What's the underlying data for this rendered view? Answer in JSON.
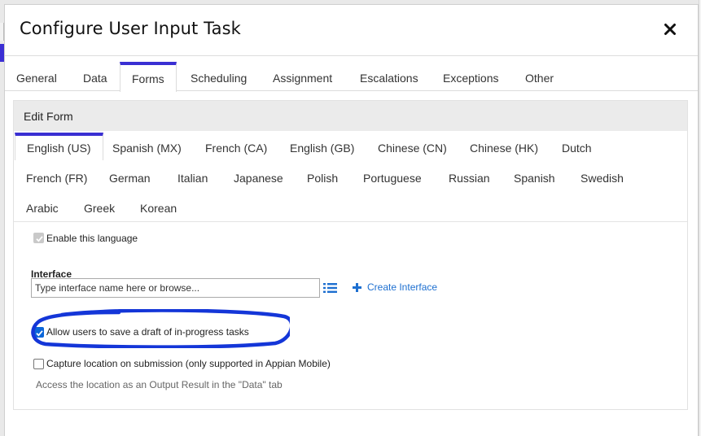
{
  "dialog": {
    "title": "Configure User Input Task",
    "close_icon": "close-icon"
  },
  "main_tabs": [
    {
      "label": "General",
      "active": false
    },
    {
      "label": "Data",
      "active": false
    },
    {
      "label": "Forms",
      "active": true
    },
    {
      "label": "Scheduling",
      "active": false
    },
    {
      "label": "Assignment",
      "active": false
    },
    {
      "label": "Escalations",
      "active": false
    },
    {
      "label": "Exceptions",
      "active": false
    },
    {
      "label": "Other",
      "active": false
    }
  ],
  "panel": {
    "title": "Edit Form"
  },
  "languages": [
    {
      "label": "English (US)",
      "active": true
    },
    {
      "label": "Spanish (MX)",
      "active": false
    },
    {
      "label": "French (CA)",
      "active": false
    },
    {
      "label": "English (GB)",
      "active": false
    },
    {
      "label": "Chinese (CN)",
      "active": false
    },
    {
      "label": "Chinese (HK)",
      "active": false
    },
    {
      "label": "Dutch",
      "active": false
    },
    {
      "label": "French (FR)",
      "active": false
    },
    {
      "label": "German",
      "active": false
    },
    {
      "label": "Italian",
      "active": false
    },
    {
      "label": "Japanese",
      "active": false
    },
    {
      "label": "Polish",
      "active": false
    },
    {
      "label": "Portuguese",
      "active": false
    },
    {
      "label": "Russian",
      "active": false
    },
    {
      "label": "Spanish",
      "active": false
    },
    {
      "label": "Swedish",
      "active": false
    },
    {
      "label": "Arabic",
      "active": false
    },
    {
      "label": "Greek",
      "active": false
    },
    {
      "label": "Korean",
      "active": false
    }
  ],
  "form": {
    "enable_language": {
      "label": "Enable this language",
      "checked": true,
      "disabled": true
    },
    "interface": {
      "label": "Interface",
      "placeholder": "Type interface name here or browse...",
      "value": "",
      "browse_icon": "list-icon",
      "create_icon": "plus-icon",
      "create_label": "Create Interface"
    },
    "allow_draft": {
      "label": "Allow users to save a draft of in-progress tasks",
      "checked": true
    },
    "capture_location": {
      "label": "Capture location on submission (only supported in Appian Mobile)",
      "checked": false
    },
    "capture_hint": "Access the location as an Output Result in the \"Data\" tab"
  },
  "colors": {
    "accent": "#3a2fd3",
    "link": "#1d6fd0",
    "checkbox": "#0b66d9",
    "annotation": "#1436d8"
  }
}
